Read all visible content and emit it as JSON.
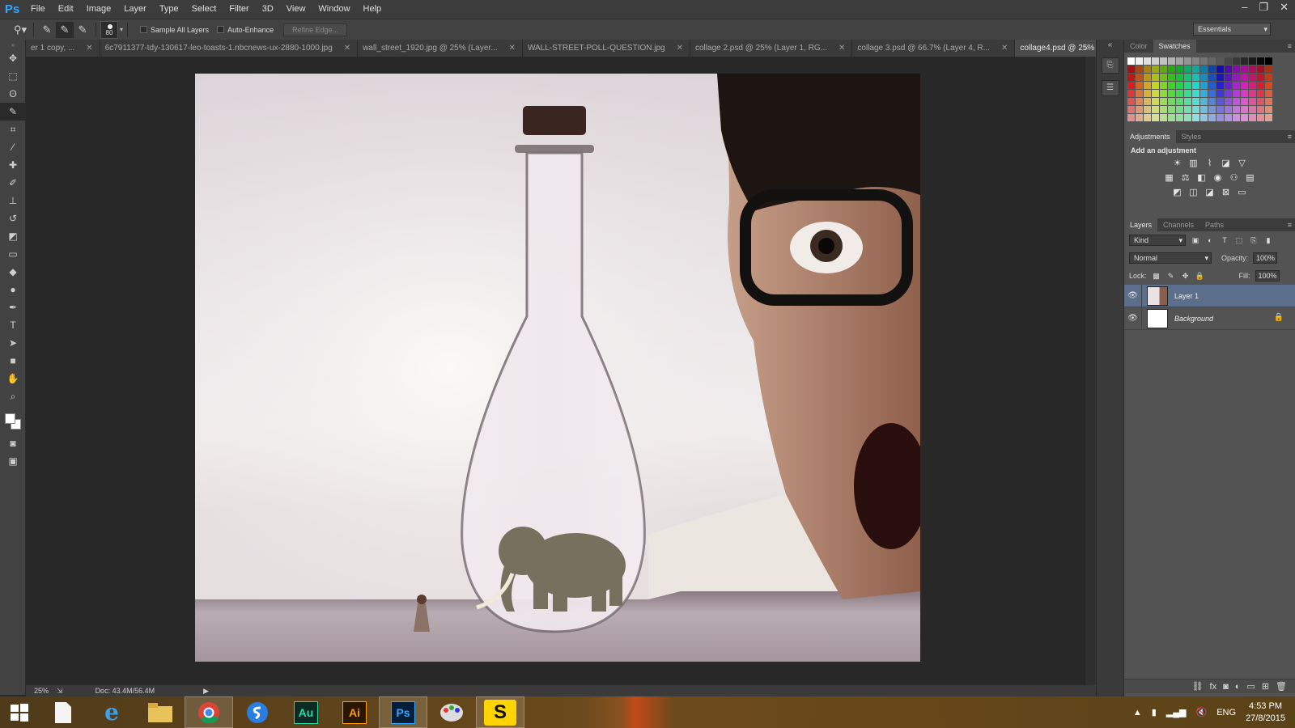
{
  "app": {
    "logo": "Ps"
  },
  "menu": [
    "File",
    "Edit",
    "Image",
    "Layer",
    "Type",
    "Select",
    "Filter",
    "3D",
    "View",
    "Window",
    "Help"
  ],
  "window_controls": {
    "minimize": "–",
    "restore": "❐",
    "close": "✕"
  },
  "options": {
    "brush_size": "80",
    "sample_all_layers": "Sample All Layers",
    "auto_enhance": "Auto-Enhance",
    "refine_edge": "Refine Edge...",
    "workspace": "Essentials"
  },
  "tabs": [
    {
      "label": "er 1 copy, ...",
      "active": false
    },
    {
      "label": "6c7911377-tdy-130617-leo-toasts-1.nbcnews-ux-2880-1000.jpg",
      "active": false
    },
    {
      "label": "wall_street_1920.jpg @ 25% (Layer...",
      "active": false
    },
    {
      "label": "WALL-STREET-POLL-QUESTION.jpg",
      "active": false
    },
    {
      "label": "collage 2.psd @ 25% (Layer 1, RG...",
      "active": false
    },
    {
      "label": "collage 3.psd @ 66.7% (Layer 4, R...",
      "active": false
    },
    {
      "label": "collage4.psd @ 25% (Layer 1, RGB/8)",
      "active": true
    }
  ],
  "status": {
    "zoom": "25%",
    "doc": "Doc: 43.4M/56.4M"
  },
  "panels": {
    "top_tabs": [
      "Color",
      "Swatches"
    ],
    "adj_tabs": [
      "Adjustments",
      "Styles"
    ],
    "adj_title": "Add an adjustment",
    "layer_tabs": [
      "Layers",
      "Channels",
      "Paths"
    ],
    "kind": "Kind",
    "blend_mode": "Normal",
    "opacity_label": "Opacity:",
    "opacity": "100%",
    "lock_label": "Lock:",
    "fill_label": "Fill:",
    "fill": "100%",
    "layers": [
      {
        "name": "Layer 1",
        "selected": true
      },
      {
        "name": "Background",
        "selected": false,
        "locked": true
      }
    ]
  },
  "taskbar": {
    "lang": "ENG",
    "time": "4:53 PM",
    "date": "27/8/2015"
  },
  "colors": {
    "accent": "#31a8ff",
    "selected_layer": "#5b6e8c"
  }
}
